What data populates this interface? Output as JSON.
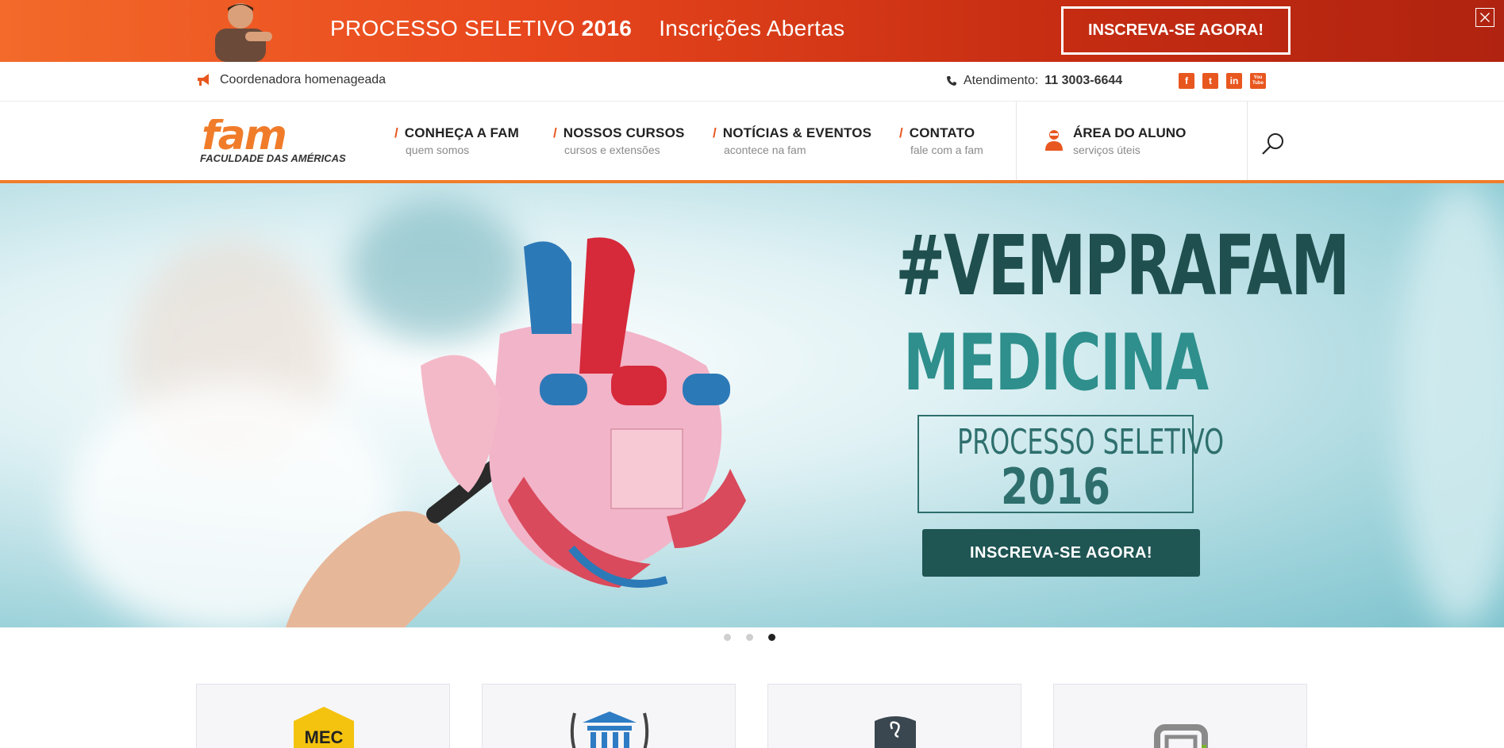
{
  "promo": {
    "title_regular": "PROCESSO SELETIVO",
    "title_bold": "2016",
    "subtitle": "Inscrições Abertas",
    "button_label": "INSCREVA-SE AGORA!",
    "close_label": "✕"
  },
  "utility": {
    "news": "Coordenadora homenageada",
    "phone_label": "Atendimento:",
    "phone_number": "11 3003-6644",
    "social": [
      {
        "name": "facebook-icon",
        "glyph": "f"
      },
      {
        "name": "twitter-icon",
        "glyph": "t"
      },
      {
        "name": "linkedin-icon",
        "glyph": "in"
      },
      {
        "name": "youtube-icon",
        "glyph": "You Tube"
      }
    ]
  },
  "nav": {
    "logo_text": "fam",
    "logo_tagline": "FACULDADE DAS AMÉRICAS",
    "slash": "/",
    "items": [
      {
        "title": "CONHEÇA A FAM",
        "sub": "quem somos"
      },
      {
        "title": "NOSSOS CURSOS",
        "sub": "cursos e extensões"
      },
      {
        "title": "NOTÍCIAS & EVENTOS",
        "sub": "acontece na fam"
      },
      {
        "title": "CONTATO",
        "sub": "fale com a fam"
      }
    ],
    "aluno": {
      "title": "ÁREA DO ALUNO",
      "sub": "serviços úteis"
    }
  },
  "hero": {
    "hashtag": "#VEMPRAFAM",
    "course": "MEDICINA",
    "box_line1": "PROCESSO SELETIVO",
    "box_line2": "2016",
    "cta": "INSCREVA-SE AGORA!"
  },
  "slider": {
    "count": 3,
    "active_index": 2
  },
  "cards": [
    {
      "icon": "mec-icon",
      "text": "MEC"
    },
    {
      "icon": "institution-laurel-icon",
      "text": ""
    },
    {
      "icon": "badge-icon",
      "text": ""
    },
    {
      "icon": "building-icon",
      "text": ""
    }
  ],
  "colors": {
    "brand_orange": "#e8571f",
    "hero_teal_dark": "#1f4f4e",
    "hero_teal": "#2e8f8c"
  }
}
